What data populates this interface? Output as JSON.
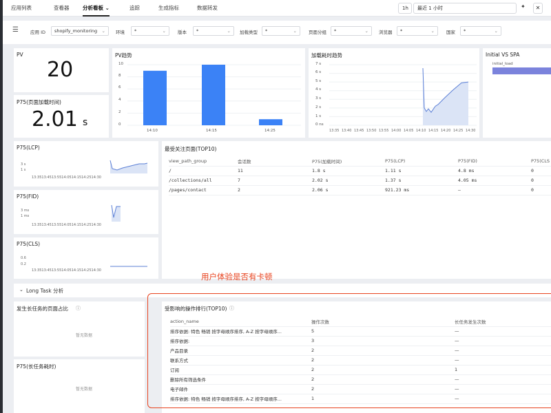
{
  "nav": {
    "tabs": [
      "应用列表",
      "查看器",
      "分析看板",
      "追踪",
      "生成指标",
      "数据转发"
    ],
    "active": "分析看板",
    "time_short": "1h",
    "time_range": "最近 1 小时"
  },
  "filters": [
    {
      "label": "应用 ID",
      "value": "shopify_monitoring"
    },
    {
      "label": "环境",
      "value": "*"
    },
    {
      "label": "版本",
      "value": "*"
    },
    {
      "label": "加载类型",
      "value": "*"
    },
    {
      "label": "页面分组",
      "value": "*"
    },
    {
      "label": "浏览器",
      "value": "*"
    },
    {
      "label": "国家",
      "value": "*"
    }
  ],
  "pv": {
    "title": "PV",
    "value": "20"
  },
  "p75_load": {
    "title": "P75(页面加载时间)",
    "value": "2.01",
    "unit": "s"
  },
  "pv_trend": {
    "title": "PV趋势",
    "chart_data": {
      "type": "bar",
      "categories": [
        "14:10",
        "14:15",
        "14:25"
      ],
      "values": [
        9,
        10,
        1
      ],
      "y_ticks": [
        "10",
        "8",
        "6",
        "4",
        "2",
        "0"
      ],
      "ylim": [
        0,
        10
      ],
      "grid": true
    }
  },
  "load_trend": {
    "title": "加载耗时趋势",
    "chart_data": {
      "type": "area",
      "x": [
        "13:35",
        "13:40",
        "13:45",
        "13:50",
        "13:55",
        "14:00",
        "14:05",
        "14:10",
        "14:15",
        "14:20",
        "14:25",
        "14:30"
      ],
      "y_ticks": [
        "7 s",
        "6 s",
        "5 s",
        "4 s",
        "3 s",
        "2 s",
        "1 s",
        "0 ns"
      ],
      "ylim": [
        0,
        7
      ],
      "grid": true
    }
  },
  "initial_spa": {
    "title": "Initial VS SPA",
    "legend": "initial_load"
  },
  "lcp": {
    "title": "P75(LCP)",
    "y_ticks": [
      "3 s",
      "1 s"
    ]
  },
  "fid": {
    "title": "P75(FID)",
    "y_ticks": [
      "3 ms",
      "1 ms"
    ]
  },
  "cls": {
    "title": "P75(CLS)",
    "y_ticks": [
      "0.6",
      "0.2"
    ]
  },
  "mini_x_ticks": [
    "13:35",
    "13:45",
    "13:55",
    "14:05",
    "14:15",
    "14:25",
    "14:30"
  ],
  "top_pages": {
    "title": "最受关注页面(TOP10)",
    "headers": [
      "view_path_group",
      "会话数",
      "P75(加载时间)",
      "P75(LCP)",
      "P75(FID)",
      "P75(CLS"
    ],
    "rows": [
      [
        "/",
        "11",
        "1.8 s",
        "1.11 s",
        "4.8 ms",
        "0"
      ],
      [
        "/collections/all",
        "7",
        "2.02 s",
        "1.37 s",
        "4.05 ms",
        "0"
      ],
      [
        "/pages/contact",
        "2",
        "2.06 s",
        "921.23 ms",
        "—",
        "0"
      ]
    ]
  },
  "longtask": {
    "toggle": "Long Task 分析"
  },
  "annotation": "用户体验是否有卡顿",
  "lt_ratio": {
    "title": "发生长任务的页面占比",
    "empty": "暂无数据"
  },
  "lt_p75": {
    "title": "P75(长任务耗时)",
    "empty": "暂无数据"
  },
  "actions": {
    "title": "受影响的操作排行(TOP10)",
    "headers": [
      "action_name",
      "操作次数",
      "长任务发生次数"
    ],
    "rows": [
      [
        "排序依据: 特色 畅销 按字母顺序排序, A-Z 按字母顺序...",
        "5",
        "—"
      ],
      [
        "排序依据:",
        "3",
        "—"
      ],
      [
        "产品目录",
        "2",
        "—"
      ],
      [
        "联系方式",
        "2",
        "—"
      ],
      [
        "订阅",
        "2",
        "1"
      ],
      [
        "删除所有筛选条件",
        "2",
        "—"
      ],
      [
        "电子邮件",
        "2",
        "—"
      ],
      [
        "排序依据: 特色 畅销 按字母顺序排序, A-Z 按字母顺序...",
        "1",
        "—"
      ]
    ]
  },
  "colors": {
    "accent": "#3b82f6",
    "area": "#dbe4f6",
    "line": "#5b7fd6",
    "annotation": "#e8431f"
  }
}
